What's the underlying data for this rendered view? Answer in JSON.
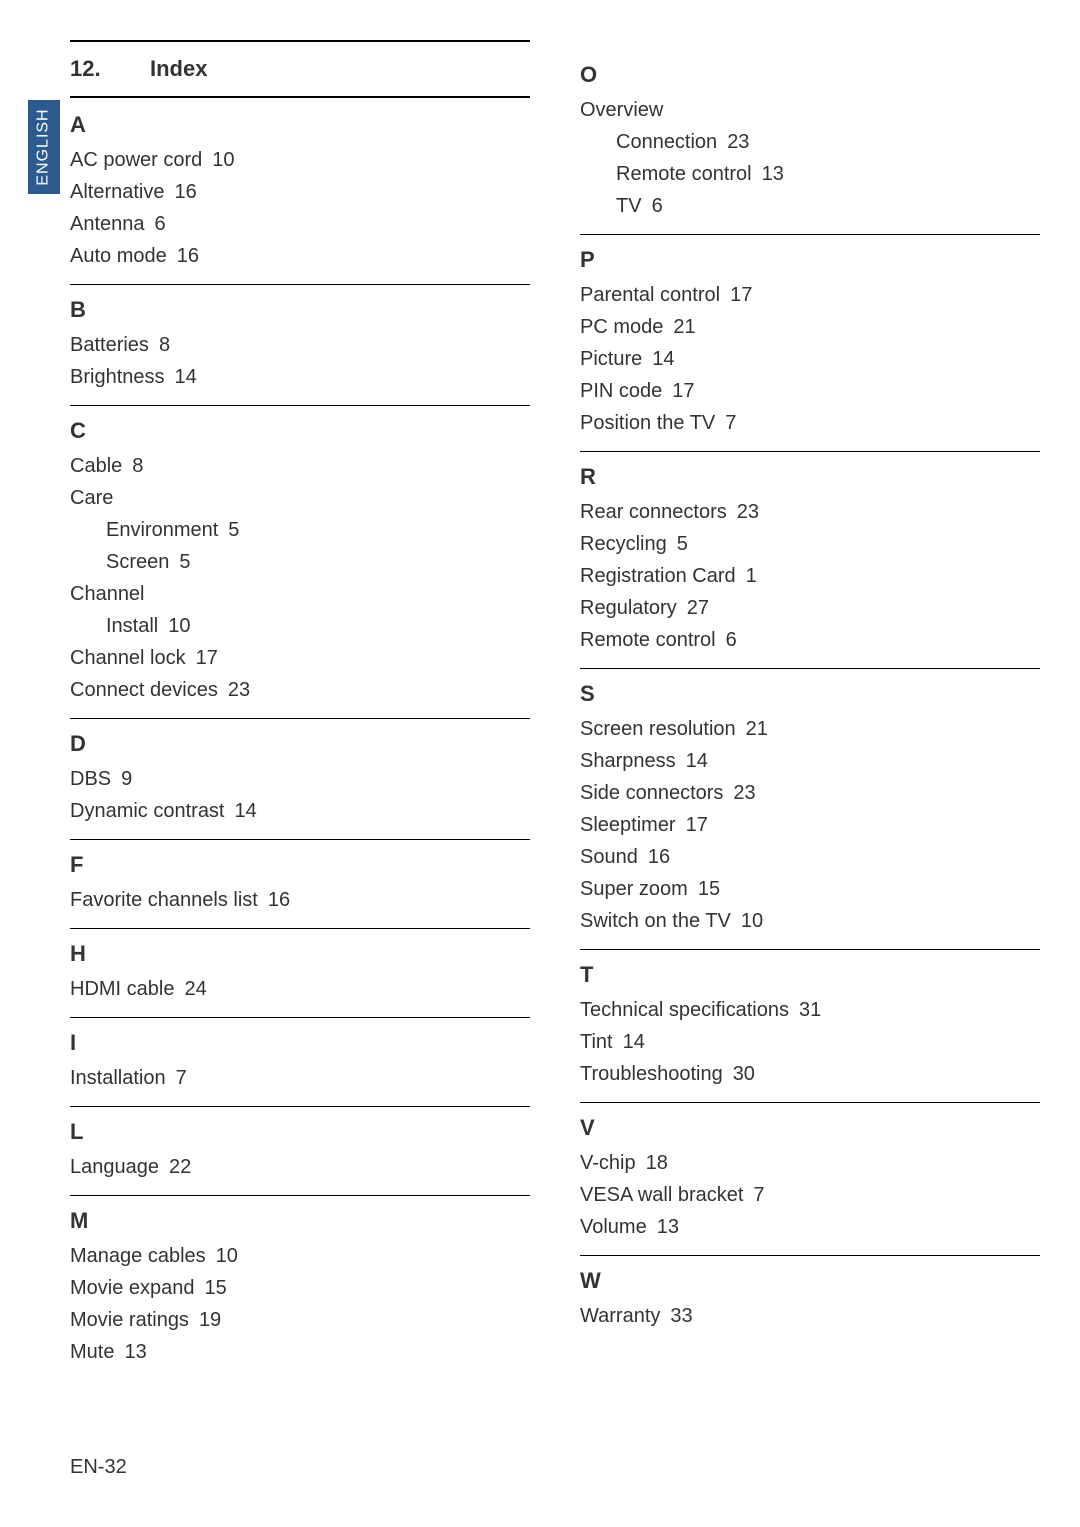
{
  "langTab": "ENGLISH",
  "heading": {
    "number": "12.",
    "title": "Index"
  },
  "pageNumber": "EN-32",
  "leftColumn": [
    {
      "letter": "A",
      "items": [
        {
          "term": "AC power cord",
          "page": "10"
        },
        {
          "term": "Alternative",
          "page": "16"
        },
        {
          "term": "Antenna",
          "page": "6"
        },
        {
          "term": "Auto mode",
          "page": "16"
        }
      ]
    },
    {
      "letter": "B",
      "items": [
        {
          "term": "Batteries",
          "page": "8"
        },
        {
          "term": "Brightness",
          "page": "14"
        }
      ]
    },
    {
      "letter": "C",
      "items": [
        {
          "term": "Cable",
          "page": "8"
        },
        {
          "term": "Care",
          "page": "",
          "subs": [
            {
              "term": "Environment",
              "page": "5"
            },
            {
              "term": "Screen",
              "page": "5"
            }
          ]
        },
        {
          "term": "Channel",
          "page": "",
          "subs": [
            {
              "term": "Install",
              "page": "10"
            }
          ]
        },
        {
          "term": "Channel lock",
          "page": "17"
        },
        {
          "term": "Connect devices",
          "page": "23"
        }
      ]
    },
    {
      "letter": "D",
      "items": [
        {
          "term": "DBS",
          "page": "9"
        },
        {
          "term": "Dynamic contrast",
          "page": "14"
        }
      ]
    },
    {
      "letter": "F",
      "items": [
        {
          "term": "Favorite channels list",
          "page": "16"
        }
      ]
    },
    {
      "letter": "H",
      "items": [
        {
          "term": "HDMI cable",
          "page": "24"
        }
      ]
    },
    {
      "letter": "I",
      "items": [
        {
          "term": "Installation",
          "page": "7"
        }
      ]
    },
    {
      "letter": "L",
      "items": [
        {
          "term": "Language",
          "page": "22"
        }
      ]
    },
    {
      "letter": "M",
      "noBorder": true,
      "items": [
        {
          "term": "Manage cables",
          "page": "10"
        },
        {
          "term": "Movie expand",
          "page": "15"
        },
        {
          "term": "Movie ratings",
          "page": "19"
        },
        {
          "term": "Mute",
          "page": "13"
        }
      ]
    }
  ],
  "rightColumn": [
    {
      "letter": "O",
      "items": [
        {
          "term": "Overview",
          "page": "",
          "subs": [
            {
              "term": "Connection",
              "page": "23"
            },
            {
              "term": "Remote control",
              "page": "13"
            },
            {
              "term": "TV",
              "page": "6"
            }
          ]
        }
      ]
    },
    {
      "letter": "P",
      "items": [
        {
          "term": "Parental control",
          "page": "17"
        },
        {
          "term": "PC mode",
          "page": "21"
        },
        {
          "term": "Picture",
          "page": "14"
        },
        {
          "term": "PIN code",
          "page": "17"
        },
        {
          "term": "Position the TV",
          "page": "7"
        }
      ]
    },
    {
      "letter": "R",
      "items": [
        {
          "term": "Rear connectors",
          "page": "23"
        },
        {
          "term": "Recycling",
          "page": "5"
        },
        {
          "term": "Registration Card",
          "page": "1"
        },
        {
          "term": "Regulatory",
          "page": "27"
        },
        {
          "term": "Remote control",
          "page": "6"
        }
      ]
    },
    {
      "letter": "S",
      "items": [
        {
          "term": "Screen resolution",
          "page": "21"
        },
        {
          "term": "Sharpness",
          "page": "14"
        },
        {
          "term": "Side connectors",
          "page": "23"
        },
        {
          "term": "Sleeptimer",
          "page": "17"
        },
        {
          "term": "Sound",
          "page": "16"
        },
        {
          "term": "Super zoom",
          "page": "15"
        },
        {
          "term": "Switch on the TV",
          "page": "10"
        }
      ]
    },
    {
      "letter": "T",
      "items": [
        {
          "term": "Technical specifications",
          "page": "31"
        },
        {
          "term": "Tint",
          "page": "14"
        },
        {
          "term": "Troubleshooting",
          "page": "30"
        }
      ]
    },
    {
      "letter": "V",
      "items": [
        {
          "term": "V-chip",
          "page": "18"
        },
        {
          "term": "VESA wall bracket",
          "page": "7"
        },
        {
          "term": "Volume",
          "page": "13"
        }
      ]
    },
    {
      "letter": "W",
      "noBorder": true,
      "items": [
        {
          "term": "Warranty",
          "page": "33"
        }
      ]
    }
  ]
}
